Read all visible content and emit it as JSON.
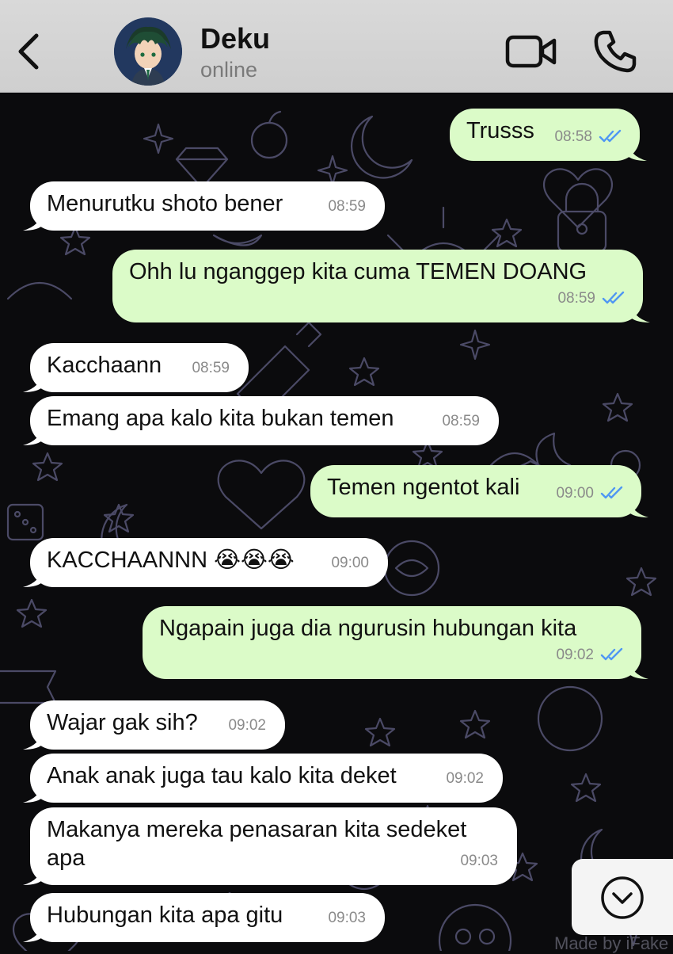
{
  "header": {
    "contact_name": "Deku",
    "status": "online",
    "icons": {
      "back": "chevron-left-icon",
      "video": "video-camera-icon",
      "call": "phone-icon"
    }
  },
  "colors": {
    "header_bg": "#d3d3d3",
    "chat_bg": "#0b0b0d",
    "incoming_bubble": "#ffffff",
    "outgoing_bubble": "#dbfbc8",
    "read_ticks": "#4f97f3"
  },
  "messages": [
    {
      "direction": "out",
      "text": "Trusss",
      "time": "08:58",
      "read": true
    },
    {
      "direction": "in",
      "text": "Menurutku shoto bener",
      "time": "08:59"
    },
    {
      "direction": "out",
      "text": "Ohh lu nganggep kita cuma TEMEN DOANG",
      "time": "08:59",
      "read": true
    },
    {
      "direction": "in",
      "text": "Kacchaann",
      "time": "08:59"
    },
    {
      "direction": "in",
      "text": "Emang apa kalo kita bukan temen",
      "time": "08:59"
    },
    {
      "direction": "out",
      "text": "Temen ngentot kali",
      "time": "09:00",
      "read": true
    },
    {
      "direction": "in",
      "text": "KACCHAANNN 😭😭😭",
      "time": "09:00"
    },
    {
      "direction": "out",
      "text": "Ngapain juga dia ngurusin hubungan kita",
      "time": "09:02",
      "read": true
    },
    {
      "direction": "in",
      "text": "Wajar gak sih?",
      "time": "09:02"
    },
    {
      "direction": "in",
      "text": "Anak anak juga tau kalo kita deket",
      "time": "09:02"
    },
    {
      "direction": "in",
      "text": "Makanya mereka penasaran kita sedeket\napa",
      "time": "09:03"
    },
    {
      "direction": "in",
      "text": "Hubungan kita apa gitu",
      "time": "09:03"
    }
  ],
  "scroll_button_icon": "chevron-down-circle-icon",
  "watermark": "Made by iFake"
}
